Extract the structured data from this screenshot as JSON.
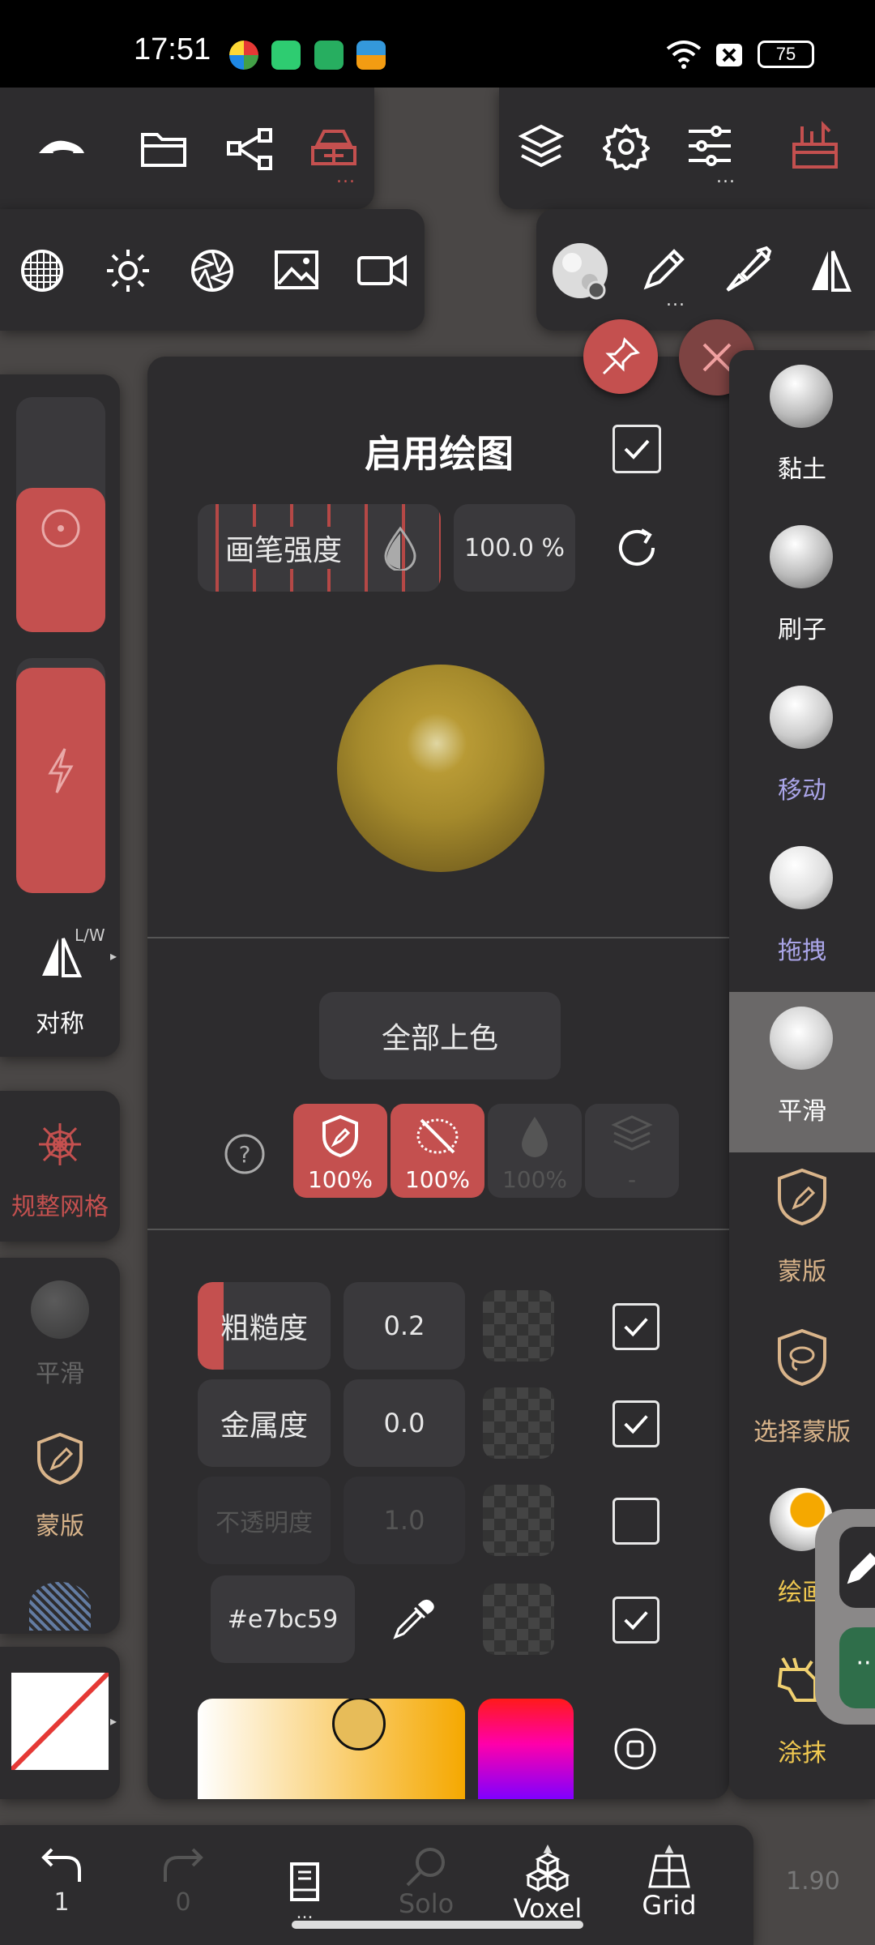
{
  "status_bar": {
    "time": "17:51",
    "battery": "75"
  },
  "top_toolbar": {
    "more_indicator": "...",
    "left_icons": [
      "logo-icon",
      "folder-icon",
      "share-icon",
      "workshop-icon"
    ],
    "right_icons": [
      "layers-icon",
      "settings-icon",
      "sliders-icon",
      "toolbox-icon"
    ]
  },
  "second_toolbar": {
    "left_icons": [
      "wireframe-sphere-icon",
      "sun-icon",
      "aperture-icon",
      "image-icon",
      "camera-icon"
    ],
    "right_icons": [
      "brush-sphere-icon",
      "pen-icon",
      "paint-brush-icon",
      "mirror-icon"
    ],
    "more_indicator": "..."
  },
  "left_panel": {
    "symmetry_label": "对称",
    "symmetry_badge": "L/W",
    "regular_mesh_label": "规整网格",
    "smooth_label": "平滑",
    "mask_label": "蒙版"
  },
  "paint_panel": {
    "title": "启用绘图",
    "enabled": true,
    "brush_intensity_label": "画笔强度",
    "brush_intensity_value": "100.0 %",
    "paint_all_button": "全部上色",
    "channels": [
      {
        "label": "100%",
        "active": true,
        "icon": "mask-shield-icon"
      },
      {
        "label": "100%",
        "active": true,
        "icon": "no-paint-icon"
      },
      {
        "label": "100%",
        "active": false,
        "icon": "drop-icon"
      },
      {
        "label": "-",
        "active": false,
        "icon": "layers-icon"
      }
    ],
    "properties": [
      {
        "label": "粗糙度",
        "value": "0.2",
        "checked": true,
        "enabled": true
      },
      {
        "label": "金属度",
        "value": "0.0",
        "checked": true,
        "enabled": true
      },
      {
        "label": "不透明度",
        "value": "1.0",
        "checked": false,
        "enabled": false
      }
    ],
    "color_hex": "#e7bc59",
    "color_checked": true,
    "material_color": "#a58a2c"
  },
  "right_tools": [
    {
      "label": "黏土",
      "color": "#ffffff"
    },
    {
      "label": "刷子",
      "color": "#ffffff"
    },
    {
      "label": "移动",
      "color": "#aaa5e8"
    },
    {
      "label": "拖拽",
      "color": "#aaa5e8"
    },
    {
      "label": "平滑",
      "color": "#ffffff",
      "selected": true
    },
    {
      "label": "蒙版",
      "color": "#d9b48a"
    },
    {
      "label": "选择蒙版",
      "color": "#d9b48a"
    },
    {
      "label": "绘画",
      "color": "#f0c850"
    },
    {
      "label": "涂抹",
      "color": "#f0c850"
    }
  ],
  "bottom_bar": {
    "undo_count": "1",
    "redo_count": "0",
    "solo_label": "Solo",
    "voxel_label": "Voxel",
    "grid_label": "Grid",
    "version": "1.90",
    "more_indicator": "..."
  },
  "colors": {
    "accent": "#c4504f",
    "panel": "#2d2c2e",
    "field": "#3a393c"
  }
}
